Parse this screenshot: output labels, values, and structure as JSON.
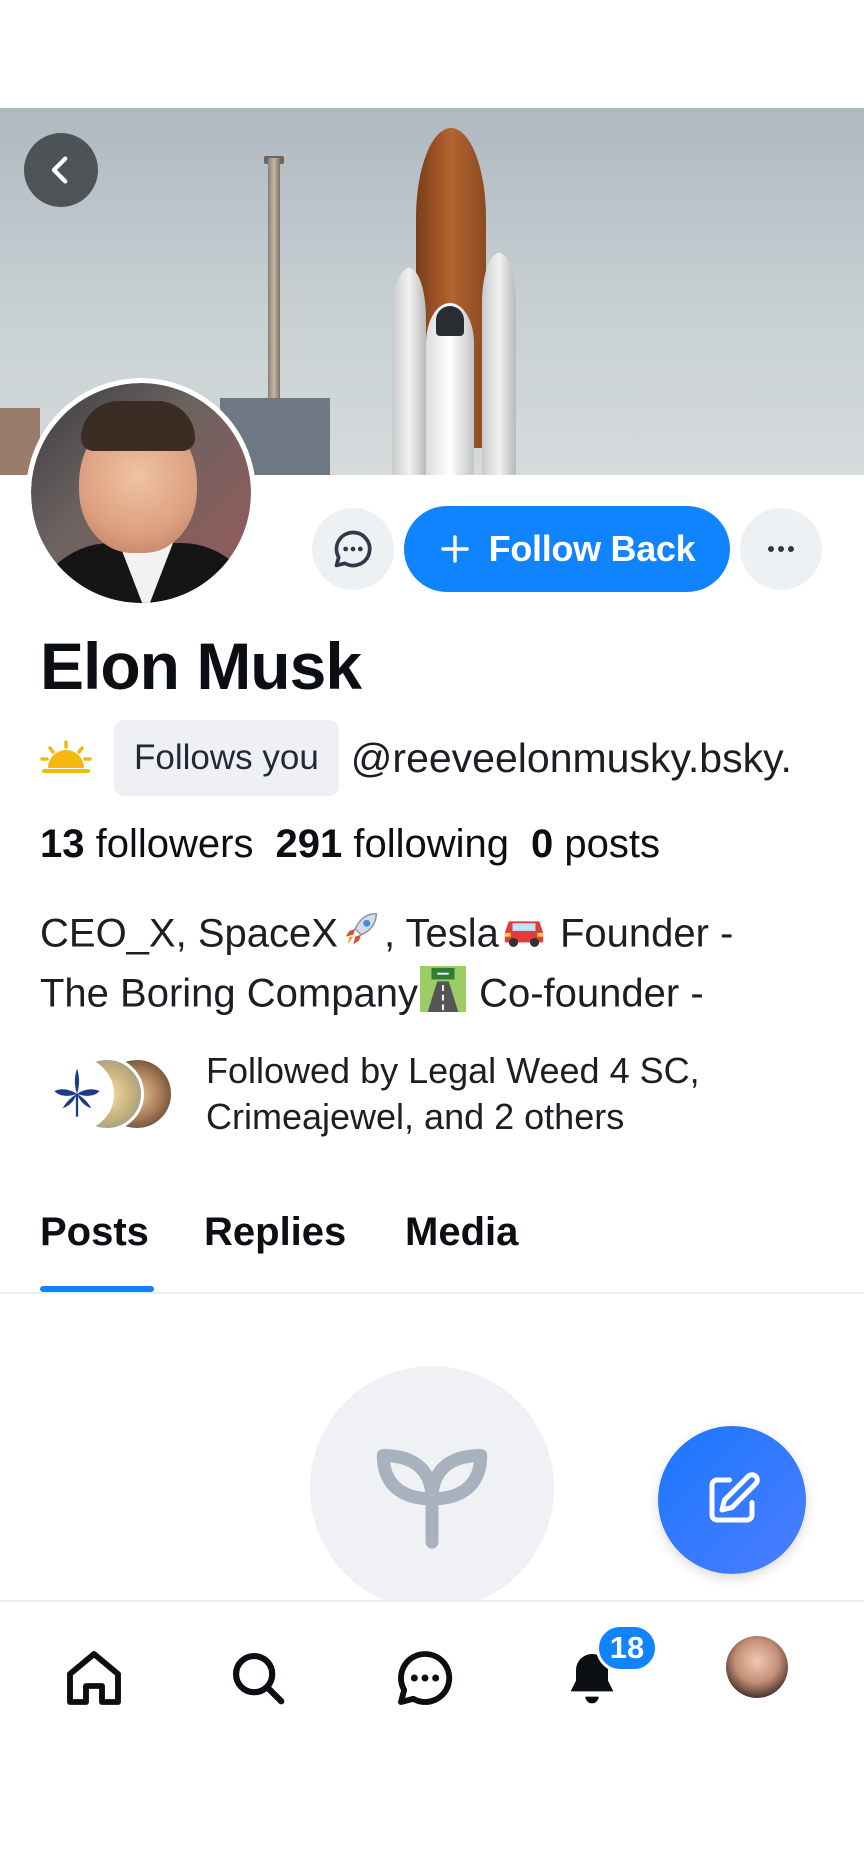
{
  "profile": {
    "display_name": "Elon Musk",
    "follows_you_label": "Follows you",
    "handle": "@reeveelonmusky.bsky.",
    "followers_count": "13",
    "followers_label": "followers",
    "following_count": "291",
    "following_label": "following",
    "posts_count": "0",
    "posts_label": "posts",
    "bio_line1_a": "CEO_X, SpaceX",
    "bio_line1_b": ", Tesla",
    "bio_line1_c": " Founder -",
    "bio_line2_a": "The Boring Company",
    "bio_line2_b": " Co-founder -",
    "followed_by_line1": "Followed by Legal Weed 4 SC,",
    "followed_by_line2": "Crimeajewel, and 2 others"
  },
  "actions": {
    "follow_back_label": "Follow Back"
  },
  "tabs": [
    {
      "label": "Posts",
      "active": true
    },
    {
      "label": "Replies",
      "active": false
    },
    {
      "label": "Media",
      "active": false
    }
  ],
  "nav": {
    "notifications_count": "18"
  },
  "colors": {
    "accent": "#1083fe",
    "fab": "#1977ff"
  },
  "icons": [
    "back-chevron-icon",
    "chat-bubble-icon",
    "plus-icon",
    "more-horizontal-icon",
    "sun-emoji-icon",
    "rocket-emoji-icon",
    "car-emoji-icon",
    "road-emoji-icon",
    "sprout-icon",
    "compose-icon",
    "home-icon",
    "search-icon",
    "chat-icon",
    "bell-icon"
  ]
}
